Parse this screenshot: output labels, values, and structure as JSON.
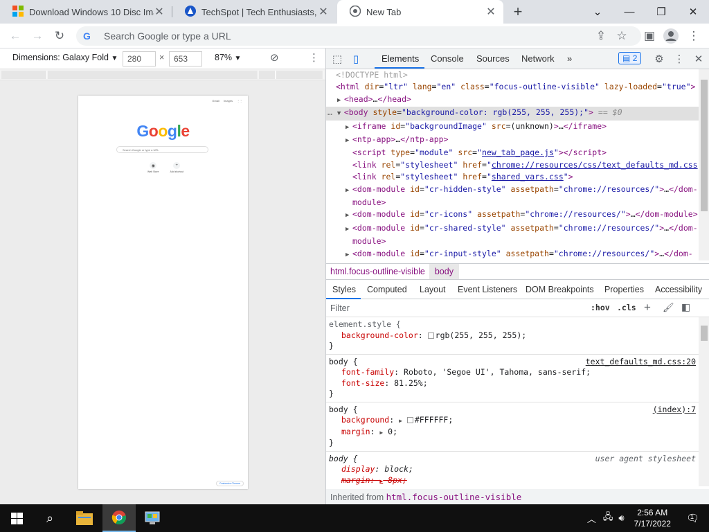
{
  "browser": {
    "tabs": [
      {
        "title": "Download Windows 10 Disc Image",
        "favicon": "windows-logo",
        "active": false
      },
      {
        "title": "TechSpot | Tech Enthusiasts, Power Users",
        "favicon": "techspot-logo",
        "active": false
      },
      {
        "title": "New Tab",
        "favicon": "chrome-logo",
        "active": true
      }
    ],
    "omnibox_placeholder": "Search Google or type a URL"
  },
  "device_toolbar": {
    "dimensions_label": "Dimensions: Galaxy Fold",
    "width": "280",
    "height": "653",
    "times": "×",
    "zoom": "87%"
  },
  "device_page": {
    "logo": "Google",
    "search_placeholder": "Search Google or type a URL",
    "top_links": [
      "Gmail",
      "Images"
    ],
    "shortcuts": [
      "Web Store",
      "Add shortcut"
    ],
    "customize": "Customize Chrome"
  },
  "devtools": {
    "tabs": [
      "Elements",
      "Console",
      "Sources",
      "Network"
    ],
    "more_tabs": "»",
    "issues_count": "2",
    "breadcrumbs": [
      "html.focus-outline-visible",
      "body"
    ],
    "styles_tabs": [
      "Styles",
      "Computed",
      "Layout",
      "Event Listeners",
      "DOM Breakpoints",
      "Properties",
      "Accessibility"
    ],
    "filter_placeholder": "Filter",
    "hov": ":hov",
    "cls": ".cls",
    "inherited_label": "Inherited from",
    "inherited_from": "html.focus-outline-visible",
    "rules": [
      {
        "selector": "element.style {",
        "source": "",
        "decls": [
          {
            "prop": "background-color",
            "val": "rgb(255, 255, 255);",
            "swatch": true
          }
        ]
      },
      {
        "selector": "body {",
        "source": "text_defaults_md.css:20",
        "decls": [
          {
            "prop": "font-family",
            "val": "Roboto, 'Segoe UI', Tahoma, sans-serif;"
          },
          {
            "prop": "font-size",
            "val": "81.25%;"
          }
        ]
      },
      {
        "selector": "body {",
        "source": "(index):7",
        "decls": [
          {
            "prop": "background",
            "val": "#FFFFFF;",
            "swatch": true
          },
          {
            "prop": "margin",
            "val": "0;"
          }
        ]
      },
      {
        "selector": "body {",
        "source": "user agent stylesheet",
        "decls": [
          {
            "prop": "display",
            "val": "block;"
          },
          {
            "prop": "margin:",
            "val": "8px;",
            "struck": true
          }
        ]
      }
    ]
  },
  "taskbar": {
    "time": "2:56 AM",
    "date": "7/17/2022",
    "notification_count": "1"
  },
  "colors": {
    "accent": "#1a73e8",
    "tag": "#881280",
    "attr_name": "#994500",
    "attr_value": "#1a1aa6",
    "prop_name": "#c80000"
  }
}
